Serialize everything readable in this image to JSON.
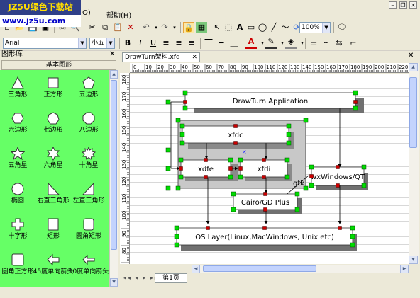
{
  "watermark": {
    "line1": "JZ5U绿色下载站",
    "line2": "www.jz5u.com"
  },
  "menubar": {
    "items": [
      {
        "label": "O)"
      },
      {
        "label": "帮助(H)"
      }
    ]
  },
  "format_toolbar": {
    "font_name": "Arial",
    "font_size": "小五",
    "zoom": "100%",
    "bold": "B",
    "italic": "I",
    "underline": "U",
    "font_color_letter": "A"
  },
  "library": {
    "title": "图形库",
    "category": "基本图形",
    "shapes": [
      {
        "label": "三角形",
        "icon": "triangle-icon"
      },
      {
        "label": "正方形",
        "icon": "square-icon"
      },
      {
        "label": "五边形",
        "icon": "pentagon-icon"
      },
      {
        "label": "六边形",
        "icon": "hexagon-icon"
      },
      {
        "label": "七边形",
        "icon": "heptagon-icon"
      },
      {
        "label": "八边形",
        "icon": "octagon-icon"
      },
      {
        "label": "五角星",
        "icon": "star5-icon"
      },
      {
        "label": "六角星",
        "icon": "star6-icon"
      },
      {
        "label": "十角星",
        "icon": "star10-icon"
      },
      {
        "label": "椭圆",
        "icon": "ellipse-icon"
      },
      {
        "label": "右直三角形",
        "icon": "right-triangle-left-icon"
      },
      {
        "label": "左直三角形",
        "icon": "right-triangle-right-icon"
      },
      {
        "label": "十字形",
        "icon": "cross-icon"
      },
      {
        "label": "矩形",
        "icon": "rectangle-icon"
      },
      {
        "label": "圆角矩形",
        "icon": "rounded-rectangle-icon"
      },
      {
        "label": "圆角正方形",
        "icon": "rounded-square-icon"
      },
      {
        "label": "45度单向箭头",
        "icon": "arrow45-icon"
      },
      {
        "label": "90度单向箭头",
        "icon": "arrow90-icon"
      }
    ]
  },
  "document": {
    "tab_label": "DrawTurn架构.xfd",
    "page_tab": "第1页",
    "hruler_ticks": [
      "0",
      "10",
      "20",
      "30",
      "40",
      "50",
      "60",
      "70",
      "80",
      "90",
      "100",
      "110",
      "120",
      "130",
      "140",
      "150",
      "160",
      "170",
      "180",
      "190",
      "200",
      "210",
      "220"
    ],
    "vruler_ticks": [
      "180",
      "170",
      "160",
      "150",
      "140",
      "130",
      "120",
      "110",
      "100",
      "90",
      "80",
      "70"
    ]
  },
  "diagram": {
    "nodes": {
      "app": "DrawTurn Application",
      "xfdc": "xfdc",
      "xdfe": "xdfe",
      "xfdi": "xfdi",
      "xgwtk": "gtk",
      "wx": "wxWindows/QT",
      "cairo": "Cairo/GD Plus",
      "os": "OS Layer(Linux,MacWindows, Unix etc)"
    }
  },
  "colors": {
    "library_bg": "#66ff66",
    "handle_fill": "#00dd00",
    "connector_fill": "#cc0000",
    "node_shadow": "#707070",
    "selection_border": "#00aa00"
  }
}
